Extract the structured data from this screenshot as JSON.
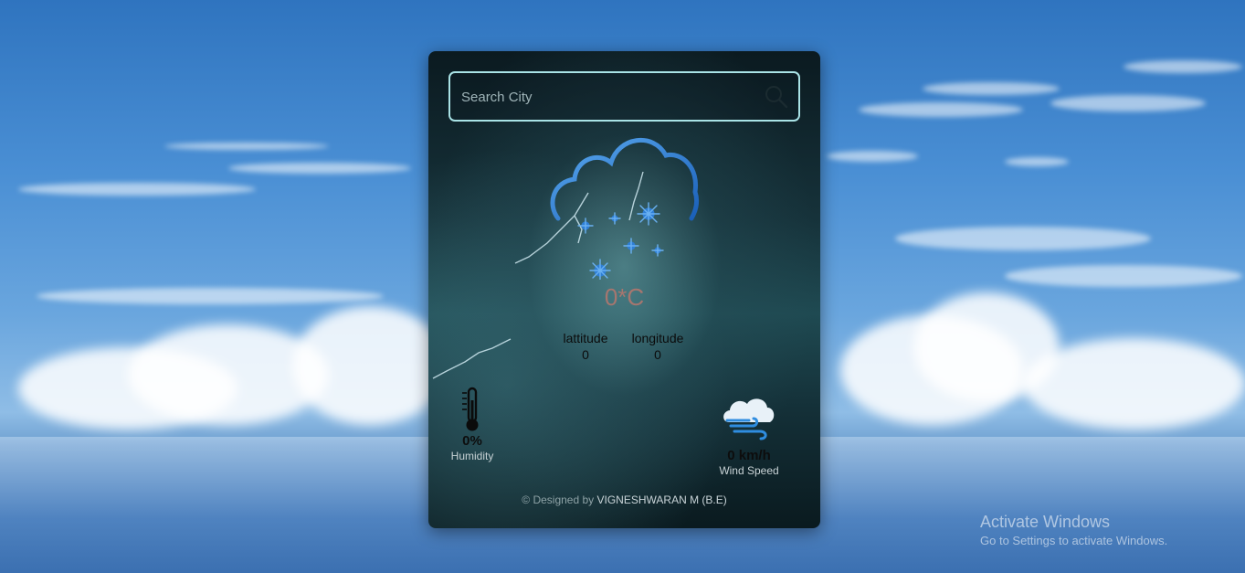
{
  "search": {
    "placeholder": "Search City",
    "value": ""
  },
  "weather": {
    "temperature": "0*C",
    "latitude_label": "lattitude",
    "latitude_value": "0",
    "longitude_label": "longitude",
    "longitude_value": "0",
    "humidity_value": "0%",
    "humidity_label": "Humidity",
    "wind_value": "0 km/h",
    "wind_label": "Wind Speed",
    "condition_icon": "snow-cloud-icon"
  },
  "footer": {
    "prefix": "© Designed by",
    "author": "VIGNESHWARAN M (B.E)"
  },
  "os_watermark": {
    "title": "Activate Windows",
    "subtitle": "Go to Settings to activate Windows."
  },
  "colors": {
    "accent_border": "#a9e3e6",
    "temperature_text": "#a6766f",
    "icon_blue": "#2f7fd6"
  }
}
